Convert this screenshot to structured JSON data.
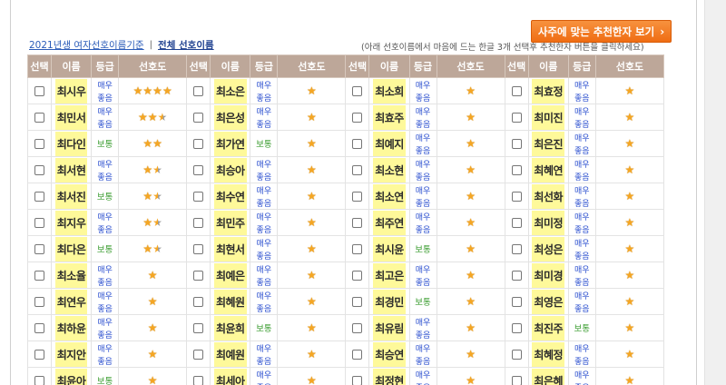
{
  "toolbar": {
    "recommend_label": "사주에 맞는 추천한자 보기",
    "recommend_chevron": "›"
  },
  "filter": {
    "year_label": "2021년생 여자선호이름기준",
    "separator": "|",
    "all_label": "전체 선호이름"
  },
  "hint": "(아래 선호이름에서 마음에 드는 한글 3개 선택후 추천한자 버튼을 클릭하세요)",
  "headers": [
    "선택",
    "이름",
    "등급",
    "선호도"
  ],
  "grade_labels": {
    "high": "매우좋음",
    "normal": "보통"
  },
  "colors": {
    "header_bg": "#bda799",
    "name_highlight": "#fef99a",
    "grade_high": "#2b4fcf",
    "grade_normal": "#3a9c2f",
    "star": "#f5a623",
    "button": "#f07a1c"
  },
  "columns": [
    [
      {
        "name": "최시우",
        "grade": "high",
        "stars": 4
      },
      {
        "name": "최민서",
        "grade": "high",
        "stars": 2.5
      },
      {
        "name": "최다인",
        "grade": "normal",
        "stars": 2
      },
      {
        "name": "최서현",
        "grade": "high",
        "stars": 1.5
      },
      {
        "name": "최서진",
        "grade": "normal",
        "stars": 1.5
      },
      {
        "name": "최지우",
        "grade": "high",
        "stars": 1.5
      },
      {
        "name": "최다은",
        "grade": "normal",
        "stars": 1.5
      },
      {
        "name": "최소율",
        "grade": "high",
        "stars": 1
      },
      {
        "name": "최연우",
        "grade": "high",
        "stars": 1
      },
      {
        "name": "최하윤",
        "grade": "high",
        "stars": 1
      },
      {
        "name": "최지안",
        "grade": "high",
        "stars": 1
      },
      {
        "name": "최윤아",
        "grade": "normal",
        "stars": 1
      }
    ],
    [
      {
        "name": "최소은",
        "grade": "high",
        "stars": 1
      },
      {
        "name": "최은성",
        "grade": "high",
        "stars": 1
      },
      {
        "name": "최가연",
        "grade": "normal",
        "stars": 1
      },
      {
        "name": "최승아",
        "grade": "high",
        "stars": 1
      },
      {
        "name": "최수연",
        "grade": "high",
        "stars": 1
      },
      {
        "name": "최민주",
        "grade": "high",
        "stars": 1
      },
      {
        "name": "최현서",
        "grade": "high",
        "stars": 1
      },
      {
        "name": "최예은",
        "grade": "high",
        "stars": 1
      },
      {
        "name": "최혜원",
        "grade": "high",
        "stars": 1
      },
      {
        "name": "최윤희",
        "grade": "normal",
        "stars": 1
      },
      {
        "name": "최예원",
        "grade": "high",
        "stars": 1
      },
      {
        "name": "최세아",
        "grade": "high",
        "stars": 1
      }
    ],
    [
      {
        "name": "최소희",
        "grade": "high",
        "stars": 1
      },
      {
        "name": "최효주",
        "grade": "high",
        "stars": 1
      },
      {
        "name": "최예지",
        "grade": "high",
        "stars": 1
      },
      {
        "name": "최소현",
        "grade": "high",
        "stars": 1
      },
      {
        "name": "최소연",
        "grade": "high",
        "stars": 1
      },
      {
        "name": "최주연",
        "grade": "high",
        "stars": 1
      },
      {
        "name": "최시윤",
        "grade": "normal",
        "stars": 1
      },
      {
        "name": "최고은",
        "grade": "high",
        "stars": 1
      },
      {
        "name": "최경민",
        "grade": "normal",
        "stars": 1
      },
      {
        "name": "최유림",
        "grade": "high",
        "stars": 1
      },
      {
        "name": "최승연",
        "grade": "high",
        "stars": 1
      },
      {
        "name": "최정현",
        "grade": "high",
        "stars": 1
      }
    ],
    [
      {
        "name": "최효정",
        "grade": "high",
        "stars": 1
      },
      {
        "name": "최미진",
        "grade": "high",
        "stars": 1
      },
      {
        "name": "최은진",
        "grade": "high",
        "stars": 1
      },
      {
        "name": "최혜연",
        "grade": "high",
        "stars": 1
      },
      {
        "name": "최선화",
        "grade": "high",
        "stars": 1
      },
      {
        "name": "최미정",
        "grade": "high",
        "stars": 1
      },
      {
        "name": "최성은",
        "grade": "high",
        "stars": 1
      },
      {
        "name": "최미경",
        "grade": "high",
        "stars": 1
      },
      {
        "name": "최영은",
        "grade": "high",
        "stars": 1
      },
      {
        "name": "최진주",
        "grade": "normal",
        "stars": 1
      },
      {
        "name": "최혜정",
        "grade": "high",
        "stars": 1
      },
      {
        "name": "최은혜",
        "grade": "high",
        "stars": 1
      }
    ]
  ]
}
